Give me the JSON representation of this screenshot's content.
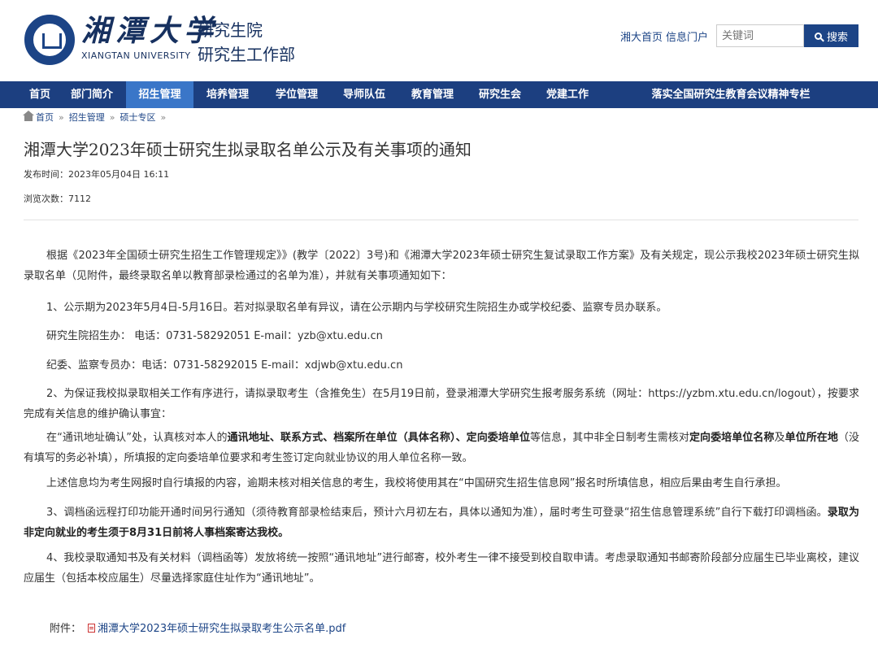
{
  "header": {
    "univ_name": "湘潭大学",
    "univ_en": "XIANGTAN UNIVERSITY",
    "dept_1": "研究生院",
    "dept_2": "研究生工作部",
    "links": [
      "湘大首页",
      "信息门户"
    ],
    "search_placeholder": "关键词",
    "search_button": "搜索"
  },
  "nav": {
    "items": [
      "首页",
      "部门简介",
      "招生管理",
      "培养管理",
      "学位管理",
      "导师队伍",
      "教育管理",
      "研究生会",
      "党建工作",
      "落实全国研究生教育会议精神专栏"
    ],
    "active": "招生管理"
  },
  "breadcrumb": [
    "首页",
    "招生管理",
    "硕士专区"
  ],
  "article": {
    "title": "湘潭大学2023年硕士研究生拟录取名单公示及有关事项的通知",
    "publish_time": "发布时间：2023年05月04日 16:11",
    "views": "浏览次数：7112",
    "paragraphs": {
      "p1": "根据《2023年全国硕士研究生招生工作管理规定》》(教学〔2022〕3号)和《湘潭大学2023年硕士研究生复试录取工作方案》及有关规定，现公示我校2023年硕士研究生拟录取名单（见附件，最终录取名单以教育部录检通过的名单为准），并就有关事项通知如下：",
      "p2": "1、公示期为2023年5月4日-5月16日。若对拟录取名单有异议，请在公示期内与学校研究生院招生办或学校纪委、监察专员办联系。",
      "p3": "研究生院招生办： 电话：0731-58292051 E-mail：yzb@xtu.edu.cn",
      "p4": "纪委、监察专员办：电话：0731-58292015 E-mail：xdjwb@xtu.edu.cn",
      "p5": "2、为保证我校拟录取相关工作有序进行，请拟录取考生（含推免生）在5月19日前，登录湘潭大学研究生报考服务系统（网址：https://yzbm.xtu.edu.cn/logout），按要求完成有关信息的维护确认事宜：",
      "p6_a": "在“通讯地址确认”处，认真核对本人的",
      "p6_b": "通讯地址",
      "p6_c": "、",
      "p6_d": "联系方式",
      "p6_e": "、",
      "p6_f": "档案所在单位（具体名称）",
      "p6_g": "、",
      "p6_h": "定向委培单位",
      "p6_i": "等信息，其中非全日制考生需核对",
      "p6_j": "定向委培单位名称",
      "p6_k": "及",
      "p6_l": "单位所在地",
      "p6_m": "（没有填写的务必补填），所填报的定向委培单位要求和考生签订定向就业协议的用人单位名称一致。",
      "p7": "上述信息均为考生网报时自行填报的内容，逾期未核对相关信息的考生，我校将使用其在“中国研究生招生信息网”报名时所填信息，相应后果由考生自行承担。",
      "p8_a": "3、调档函远程打印功能开通时间另行通知（须待教育部录检结束后，预计六月初左右，具体以通知为准），届时考生可登录“招生信息管理系统”自行下载打印调档函。",
      "p8_b": "录取为非定向就业的考生须于8月31日前将人事档案寄达我校。",
      "p9": "4、我校录取通知书及有关材料（调档函等）发放将统一按照“通讯地址”进行邮寄，校外考生一律不接受到校自取申请。考虑录取通知书邮寄阶段部分应届生已毕业离校，建议应届生（包括本校应届生）尽量选择家庭住址作为“通讯地址”。"
    },
    "attachment_label": "附件：",
    "attachment_file": "湘潭大学2023年硕士研究生拟录取考生公示名单.pdf"
  },
  "colors": {
    "brand": "#1c3f80",
    "nav_active": "#3a76c8",
    "link": "#1c4486"
  }
}
